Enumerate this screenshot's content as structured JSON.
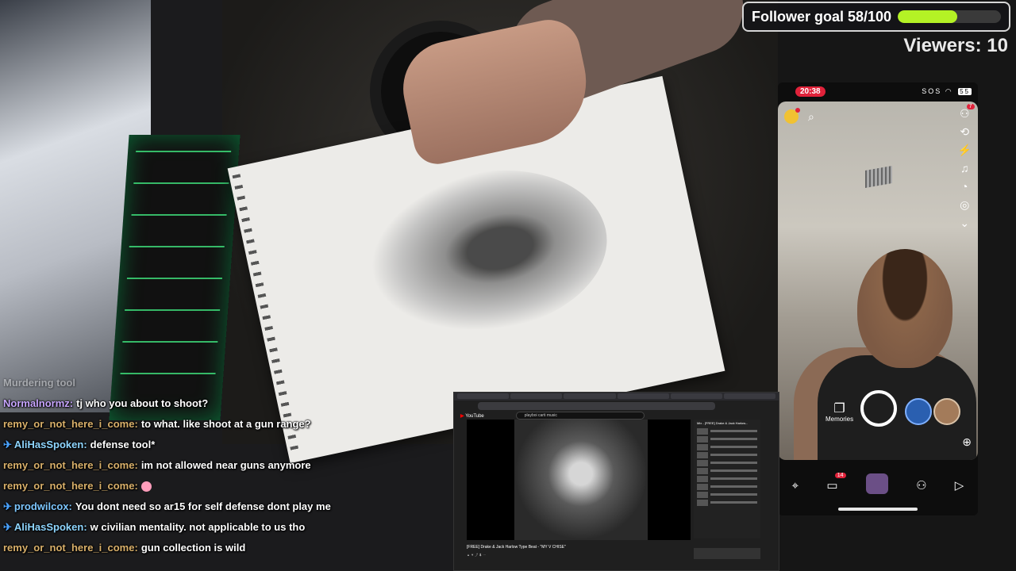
{
  "follower_goal": {
    "label": "Follower goal 58/100",
    "current": 58,
    "target": 100,
    "fill_color": "#b4f225"
  },
  "viewers": {
    "label": "Viewers: 10"
  },
  "phone": {
    "time": "20:38",
    "status": "SOS",
    "battery": "55",
    "notifications_badge": "7",
    "memories_label": "Memories",
    "nav_chat_badge": "14"
  },
  "chat": {
    "faded_line": "Murdering tool",
    "messages": [
      {
        "user": "Normalnormz:",
        "text": "tj who you about to shoot?",
        "pinned": false
      },
      {
        "user": "remy_or_not_here_i_come:",
        "text": "to what. like shoot at a gun range?",
        "pinned": false
      },
      {
        "user": "AliHasSpoken:",
        "text": "defense tool*",
        "pinned": true
      },
      {
        "user": "remy_or_not_here_i_come:",
        "text": "im not allowed near guns anymore",
        "pinned": false
      },
      {
        "user": "remy_or_not_here_i_come:",
        "text": "",
        "pinned": false,
        "emote": "face-emote"
      },
      {
        "user": "prodwilcox:",
        "text": "You dont need so ar15 for self defense dont play me",
        "pinned": true
      },
      {
        "user": "AliHasSpoken:",
        "text": "w civilian mentality. not applicable to us tho",
        "pinned": true
      },
      {
        "user": "remy_or_not_here_i_come:",
        "text": "gun collection is wild",
        "pinned": false
      }
    ]
  },
  "screen_share": {
    "yt_logo": "YouTube",
    "search_query": "playboi carti music",
    "video_title": "[FREE] Drake & Jack Harlow Type Beat - \"MY V CHISE\"",
    "playlist_title": "Mix - [FREE] Drake & Jack Harlow..."
  }
}
